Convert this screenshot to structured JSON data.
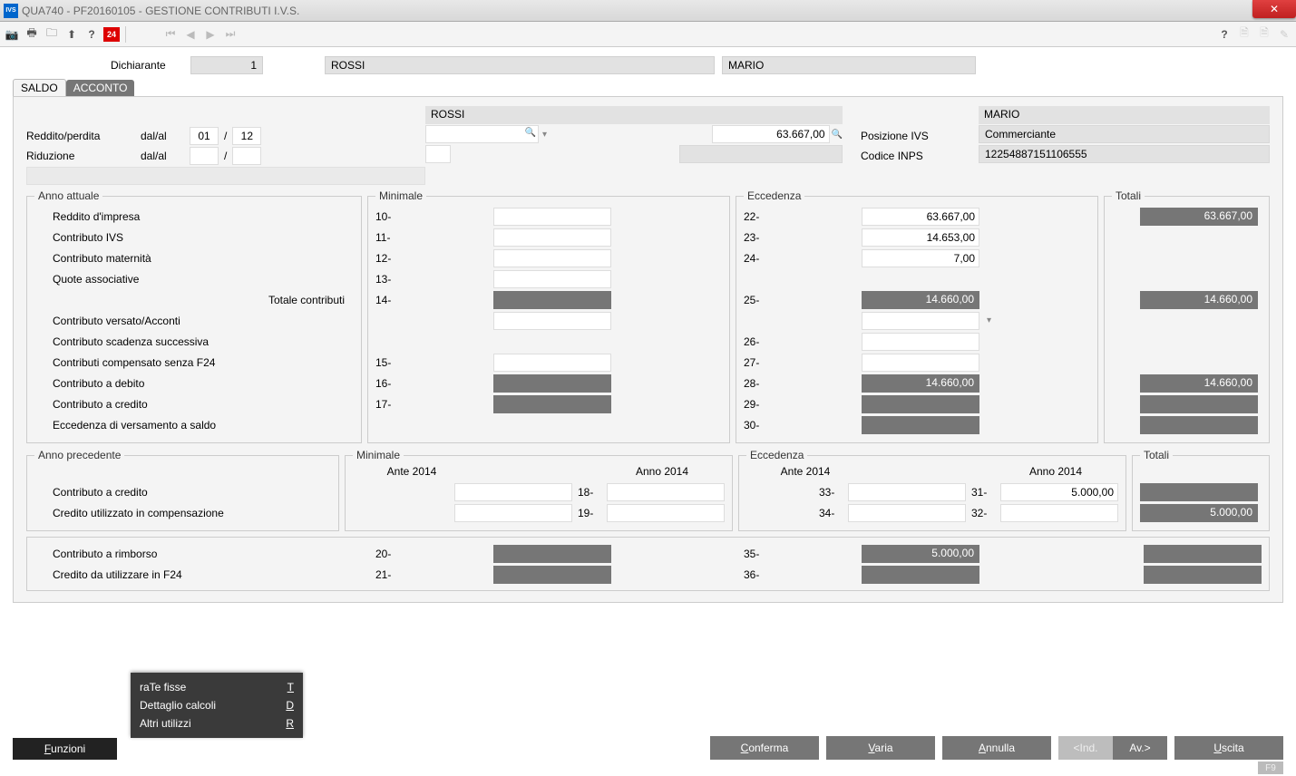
{
  "window": {
    "title": "QUA740  -  PF20160105 -   GESTIONE CONTRIBUTI I.V.S."
  },
  "toolbar": {
    "badge24": "24"
  },
  "header": {
    "dichiarante_label": "Dichiarante",
    "dichiarante_num": "1",
    "cognome": "ROSSI",
    "nome": "MARIO"
  },
  "tabs": {
    "saldo": "SALDO",
    "acconto": "ACCONTO"
  },
  "form": {
    "cognome2": "ROSSI",
    "nome2": "MARIO",
    "reddito_perdita": "Reddito/perdita",
    "dal_al": "dal/al",
    "mese_da": "01",
    "mese_a": "12",
    "riduzione": "Riduzione",
    "importo_top": "63.667,00",
    "posizione_ivs_lbl": "Posizione IVS",
    "posizione_ivs": "Commerciante",
    "codice_inps_lbl": "Codice INPS",
    "codice_inps": "12254887151106555"
  },
  "groups": {
    "anno_attuale": "Anno attuale",
    "minimale": "Minimale",
    "eccedenza": "Eccedenza",
    "totali": "Totali",
    "anno_precedente": "Anno precedente",
    "ante": "Ante 2014",
    "anno2014": "Anno 2014"
  },
  "rows": {
    "reddito_impresa": "Reddito d'impresa",
    "contributo_ivs": "Contributo IVS",
    "contributo_maternita": "Contributo maternità",
    "quote_associative": "Quote associative",
    "totale_contributi": "Totale contributi",
    "contributo_versato": "Contributo versato/Acconti",
    "contributo_scadenza": "Contributo scadenza successiva",
    "contributi_comp": "Contributi compensato senza F24",
    "contributo_debito": "Contributo a debito",
    "contributo_credito": "Contributo a credito",
    "eccedenza_vers": "Eccedenza di versamento a saldo",
    "credito_util_comp": "Credito utilizzato in compensazione",
    "contributo_rimborso": "Contributo a rimborso",
    "credito_f24": "Credito da utilizzare in F24"
  },
  "codes": {
    "c10": "10-",
    "c11": "11-",
    "c12": "12-",
    "c13": "13-",
    "c14": "14-",
    "c15": "15-",
    "c16": "16-",
    "c17": "17-",
    "c18": "18-",
    "c19": "19-",
    "c20": "20-",
    "c21": "21-",
    "c22": "22-",
    "c23": "23-",
    "c24": "24-",
    "c25": "25-",
    "c26": "26-",
    "c27": "27-",
    "c28": "28-",
    "c29": "29-",
    "c30": "30-",
    "c31": "31-",
    "c32": "32-",
    "c33": "33-",
    "c34": "34-",
    "c35": "35-",
    "c36": "36-"
  },
  "values": {
    "e22": "63.667,00",
    "e23": "14.653,00",
    "e24": "7,00",
    "e25": "14.660,00",
    "e28": "14.660,00",
    "e31": "5.000,00",
    "e35": "5.000,00",
    "t_reddito": "63.667,00",
    "t_totale": "14.660,00",
    "t_debito": "14.660,00",
    "t_cred_comp": "5.000,00"
  },
  "popup": {
    "rate_fisse": "raTe fisse",
    "rate_fisse_k": "T",
    "dettaglio": "Dettaglio calcoli",
    "dettaglio_k": "D",
    "altri": "Altri utilizzi",
    "altri_k": "R"
  },
  "buttons": {
    "funzioni": "Funzioni",
    "conferma": "Conferma",
    "varia": "Varia",
    "annulla": "Annulla",
    "ind": "<Ind.",
    "av": "Av.>",
    "uscita": "Uscita",
    "f9": "F9"
  }
}
